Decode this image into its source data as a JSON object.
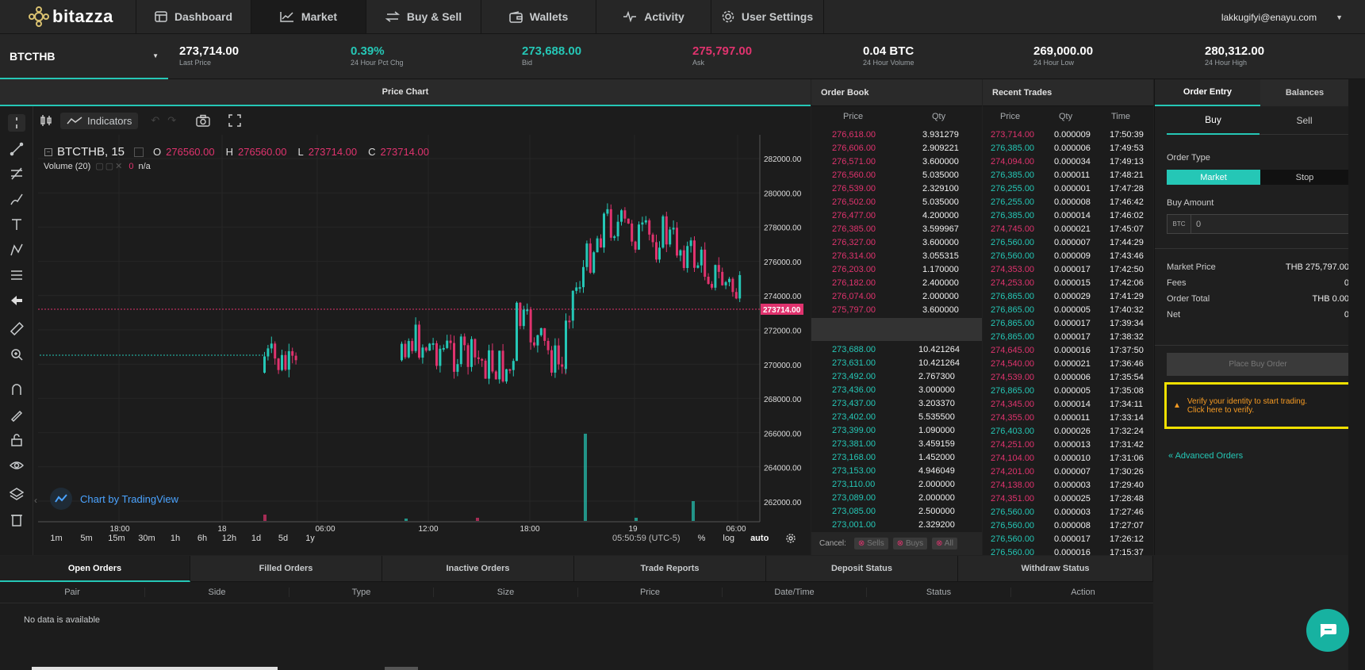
{
  "brand": {
    "name": "bitazza"
  },
  "nav": {
    "tabs": [
      {
        "label": "Dashboard"
      },
      {
        "label": "Market"
      },
      {
        "label": "Buy & Sell"
      },
      {
        "label": "Wallets"
      },
      {
        "label": "Activity"
      },
      {
        "label": "User Settings"
      }
    ],
    "user_email": "lakkugifyi@enayu.com"
  },
  "ticker": {
    "pair": "BTCTHB",
    "stats": [
      {
        "value": "273,714.00",
        "label": "Last Price",
        "color": "white"
      },
      {
        "value": "0.39%",
        "label": "24 Hour Pct Chg",
        "color": "teal"
      },
      {
        "value": "273,688.00",
        "label": "Bid",
        "color": "teal"
      },
      {
        "value": "275,797.00",
        "label": "Ask",
        "color": "red"
      },
      {
        "value": "0.04 BTC",
        "label": "24 Hour Volume",
        "color": "white"
      },
      {
        "value": "269,000.00",
        "label": "24 Hour Low",
        "color": "white"
      },
      {
        "value": "280,312.00",
        "label": "24 Hour High",
        "color": "white"
      }
    ]
  },
  "panels": {
    "price_chart": "Price Chart",
    "order_book": "Order Book",
    "recent_trades": "Recent Trades",
    "order_entry": "Order Entry",
    "balances": "Balances"
  },
  "chart": {
    "indicators_label": "Indicators",
    "symbol": "BTCTHB, 15",
    "ohlc": {
      "o_label": "O",
      "o": "276560.00",
      "h_label": "H",
      "h": "276560.00",
      "l_label": "L",
      "l": "273714.00",
      "c_label": "C",
      "c": "273714.00"
    },
    "volume_label": "Volume (20)",
    "volume_value": "0",
    "volume_na": "n/a",
    "y_ticks": [
      "282000.00",
      "280000.00",
      "278000.00",
      "276000.00",
      "274000.00",
      "272000.00",
      "270000.00",
      "268000.00",
      "266000.00",
      "264000.00",
      "262000.00"
    ],
    "x_ticks": [
      "18:00",
      "18",
      "06:00",
      "12:00",
      "18:00",
      "19",
      "06:00"
    ],
    "last_price_tag": "273714.00",
    "intervals": [
      "1m",
      "5m",
      "15m",
      "30m",
      "1h",
      "6h",
      "12h",
      "1d",
      "5d",
      "1y"
    ],
    "clock": "05:50:59 (UTC-5)",
    "pct": "%",
    "log": "log",
    "auto": "auto",
    "attribution": "Chart by TradingView"
  },
  "chart_data": {
    "type": "candlestick",
    "ylim": [
      261000,
      283000
    ]
  },
  "order_book": {
    "headers": [
      "Price",
      "Qty"
    ],
    "asks": [
      [
        "276,618.00",
        "3.931279"
      ],
      [
        "276,606.00",
        "2.909221"
      ],
      [
        "276,571.00",
        "3.600000"
      ],
      [
        "276,560.00",
        "5.035000"
      ],
      [
        "276,539.00",
        "2.329100"
      ],
      [
        "276,502.00",
        "5.035000"
      ],
      [
        "276,477.00",
        "4.200000"
      ],
      [
        "276,385.00",
        "3.599967"
      ],
      [
        "276,327.00",
        "3.600000"
      ],
      [
        "276,314.00",
        "3.055315"
      ],
      [
        "276,203.00",
        "1.170000"
      ],
      [
        "276,182.00",
        "2.400000"
      ],
      [
        "276,074.00",
        "2.000000"
      ],
      [
        "275,797.00",
        "3.600000"
      ]
    ],
    "bids": [
      [
        "273,688.00",
        "10.421264"
      ],
      [
        "273,631.00",
        "10.421264"
      ],
      [
        "273,492.00",
        "2.767300"
      ],
      [
        "273,436.00",
        "3.000000"
      ],
      [
        "273,437.00",
        "3.203370"
      ],
      [
        "273,402.00",
        "5.535500"
      ],
      [
        "273,399.00",
        "1.090000"
      ],
      [
        "273,381.00",
        "3.459159"
      ],
      [
        "273,168.00",
        "1.452000"
      ],
      [
        "273,153.00",
        "4.946049"
      ],
      [
        "273,110.00",
        "2.000000"
      ],
      [
        "273,089.00",
        "2.000000"
      ],
      [
        "273,085.00",
        "2.500000"
      ],
      [
        "273,001.00",
        "2.329200"
      ]
    ],
    "cancel_label": "Cancel:",
    "cancel_sells": "Sells",
    "cancel_buys": "Buys",
    "cancel_all": "All"
  },
  "recent_trades": {
    "headers": [
      "Price",
      "Qty",
      "Time"
    ],
    "rows": [
      [
        "273,714.00",
        "0.000009",
        "17:50:39",
        "red"
      ],
      [
        "276,385.00",
        "0.000006",
        "17:49:53",
        "teal"
      ],
      [
        "274,094.00",
        "0.000034",
        "17:49:13",
        "red"
      ],
      [
        "276,385.00",
        "0.000011",
        "17:48:21",
        "teal"
      ],
      [
        "276,255.00",
        "0.000001",
        "17:47:28",
        "teal"
      ],
      [
        "276,255.00",
        "0.000008",
        "17:46:42",
        "teal"
      ],
      [
        "276,385.00",
        "0.000014",
        "17:46:02",
        "teal"
      ],
      [
        "274,745.00",
        "0.000021",
        "17:45:07",
        "red"
      ],
      [
        "276,560.00",
        "0.000007",
        "17:44:29",
        "teal"
      ],
      [
        "276,560.00",
        "0.000009",
        "17:43:46",
        "teal"
      ],
      [
        "274,353.00",
        "0.000017",
        "17:42:50",
        "red"
      ],
      [
        "274,253.00",
        "0.000015",
        "17:42:06",
        "red"
      ],
      [
        "276,865.00",
        "0.000029",
        "17:41:29",
        "teal"
      ],
      [
        "276,865.00",
        "0.000005",
        "17:40:32",
        "teal"
      ],
      [
        "276,865.00",
        "0.000017",
        "17:39:34",
        "teal"
      ],
      [
        "276,865.00",
        "0.000017",
        "17:38:32",
        "teal"
      ],
      [
        "274,645.00",
        "0.000016",
        "17:37:50",
        "red"
      ],
      [
        "274,540.00",
        "0.000021",
        "17:36:46",
        "red"
      ],
      [
        "274,539.00",
        "0.000006",
        "17:35:54",
        "red"
      ],
      [
        "276,865.00",
        "0.000005",
        "17:35:08",
        "teal"
      ],
      [
        "274,345.00",
        "0.000014",
        "17:34:11",
        "red"
      ],
      [
        "274,355.00",
        "0.000011",
        "17:33:14",
        "red"
      ],
      [
        "276,403.00",
        "0.000026",
        "17:32:24",
        "teal"
      ],
      [
        "274,251.00",
        "0.000013",
        "17:31:42",
        "red"
      ],
      [
        "274,104.00",
        "0.000010",
        "17:31:06",
        "red"
      ],
      [
        "274,201.00",
        "0.000007",
        "17:30:26",
        "red"
      ],
      [
        "274,138.00",
        "0.000003",
        "17:29:40",
        "red"
      ],
      [
        "274,351.00",
        "0.000025",
        "17:28:48",
        "red"
      ],
      [
        "276,560.00",
        "0.000003",
        "17:27:46",
        "teal"
      ],
      [
        "276,560.00",
        "0.000008",
        "17:27:07",
        "teal"
      ],
      [
        "276,560.00",
        "0.000017",
        "17:26:12",
        "teal"
      ],
      [
        "276,560.00",
        "0.000016",
        "17:15:37",
        "teal"
      ]
    ]
  },
  "order_entry": {
    "buy": "Buy",
    "sell": "Sell",
    "order_type_label": "Order Type",
    "market": "Market",
    "stop": "Stop",
    "buy_amount_label": "Buy Amount",
    "currency": "BTC",
    "amount_value": "0",
    "summary": [
      [
        "Market Price",
        "THB 275,797.00"
      ],
      [
        "Fees",
        "0"
      ],
      [
        "Order Total",
        "THB 0.00"
      ],
      [
        "Net",
        "0"
      ]
    ],
    "place_order": "Place Buy Order",
    "verify_line1": "Verify your identity to start trading.",
    "verify_line2": "Click here to verify.",
    "advanced": "« Advanced Orders"
  },
  "bottom": {
    "tabs": [
      "Open Orders",
      "Filled Orders",
      "Inactive Orders",
      "Trade Reports",
      "Deposit Status",
      "Withdraw Status"
    ],
    "columns": [
      "Pair",
      "Side",
      "Type",
      "Size",
      "Price",
      "Date/Time",
      "Status",
      "Action"
    ],
    "empty": "No data is available"
  },
  "colors": {
    "accent": "#25c7b6",
    "down": "#e0336e",
    "warning": "#f0e000",
    "warning_text": "#f59a23"
  }
}
